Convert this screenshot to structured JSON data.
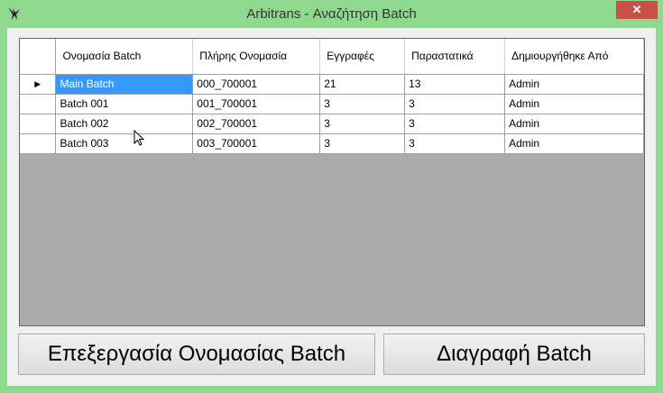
{
  "window": {
    "title": "Arbitrans - Αναζήτηση Batch",
    "close_glyph": "✕"
  },
  "grid": {
    "columns": [
      {
        "label": "Ονομασία Batch"
      },
      {
        "label": "Πλήρης Ονομασία"
      },
      {
        "label": "Εγγραφές"
      },
      {
        "label": "Παραστατικά"
      },
      {
        "label": "Δημιουργήθηκε Από"
      }
    ],
    "current_row_marker": "▶",
    "rows": [
      [
        "Main Batch",
        "000_700001",
        "21",
        "13",
        "Admin"
      ],
      [
        "Batch 001",
        "001_700001",
        "3",
        "3",
        "Admin"
      ],
      [
        "Batch 002",
        "002_700001",
        "3",
        "3",
        "Admin"
      ],
      [
        "Batch 003",
        "003_700001",
        "3",
        "3",
        "Admin"
      ]
    ]
  },
  "buttons": {
    "edit_label": "Επεξεργασία Ονομασίας Batch",
    "delete_label": "Διαγραφή Batch"
  }
}
